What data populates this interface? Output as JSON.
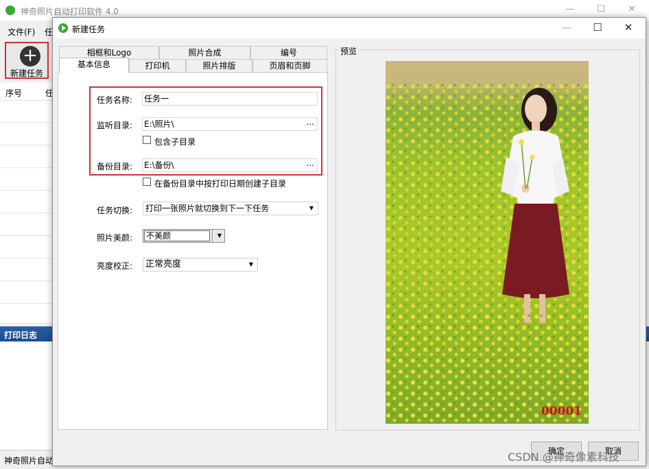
{
  "main_window": {
    "title": "神奇照片自动打印软件 4.0",
    "menu": [
      "文件(F)",
      "任"
    ],
    "toolbar_new_task": "新建任务",
    "list_headers": [
      "序号",
      "任"
    ],
    "log_title": "打印日志",
    "status_text": "神奇照片自动"
  },
  "dialog": {
    "title": "新建任务",
    "tabs_top": [
      "相框和Logo",
      "照片合成",
      "编号"
    ],
    "tabs_bottom": [
      "基本信息",
      "打印机",
      "照片排版",
      "页眉和页脚"
    ],
    "active_tab": "基本信息",
    "fields": {
      "task_name_label": "任务名称:",
      "task_name_value": "任务一",
      "watch_dir_label": "监听目录:",
      "watch_dir_value": "E:\\照片\\",
      "include_subdir_label": "包含子目录",
      "backup_dir_label": "备份目录:",
      "backup_dir_value": "E:\\备份\\",
      "create_date_subdir_label": "在备份目录中按打印日期创建子目录",
      "task_switch_label": "任务切换:",
      "task_switch_value": "打印一张照片就切换到下一下任务",
      "beauty_label": "照片美颜:",
      "beauty_value": "不美颜",
      "brightness_label": "亮度校正:",
      "brightness_value": "正常亮度"
    },
    "browse_label": "...",
    "preview_label": "预览",
    "preview_number": "00001",
    "ok_label": "确定",
    "cancel_label": "取消"
  },
  "watermark": "CSDN @神奇像素科技",
  "colors": {
    "highlight_red": "#d0303a",
    "log_bar_blue": "#2a5ea8",
    "app_icon_green": "#3aa832",
    "preview_number_red": "#d01010"
  }
}
